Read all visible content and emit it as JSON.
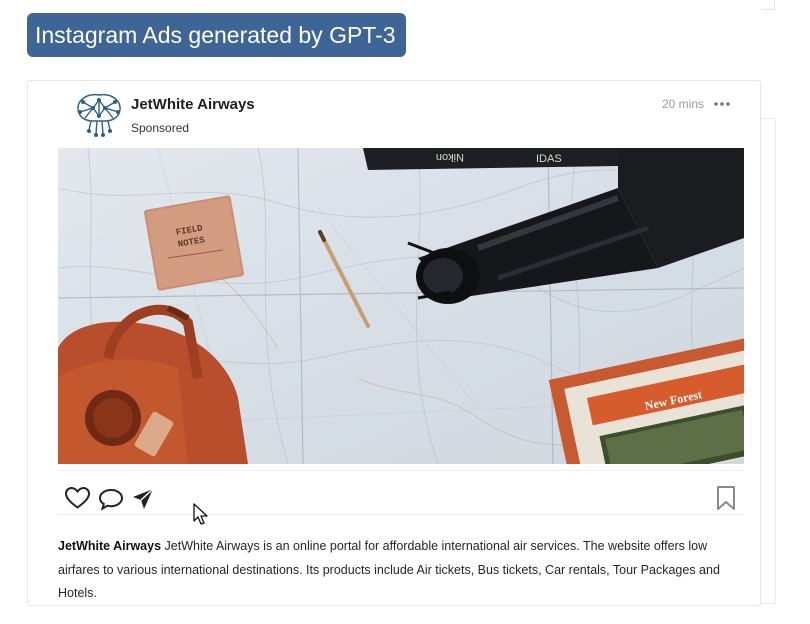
{
  "header": {
    "title": "Instagram Ads generated by GPT-3"
  },
  "post": {
    "account_name": "JetWhite Airways",
    "sponsored_label": "Sponsored",
    "time_ago": "20 mins",
    "avatar_icon": "brain-circuit-logo",
    "image": {
      "description_icon": "travel-flatlay-photo",
      "camera_strap_text": "Nikon",
      "camera_strap_text_2": "IDAS",
      "notebook_text_1": "FIELD",
      "notebook_text_2": "NOTES",
      "brochure_text": "New Forest"
    },
    "actions": {
      "like_icon": "heart-icon",
      "comment_icon": "comment-icon",
      "share_icon": "send-icon",
      "save_icon": "bookmark-icon"
    },
    "caption": {
      "account": "JetWhite Airways",
      "text": "JetWhite Airways is an online portal for affordable international air services. The website offers low airfares to various international destinations. Its products include Air tickets, Bus tickets, Car rentals, Tour Packages and Hotels."
    }
  },
  "colors": {
    "badge_background": "#3d6596",
    "badge_text": "#ffffff",
    "avatar_blue": "#2e5f8a",
    "icon_dark": "#222222",
    "bookmark_gray": "#8a8a8a"
  }
}
